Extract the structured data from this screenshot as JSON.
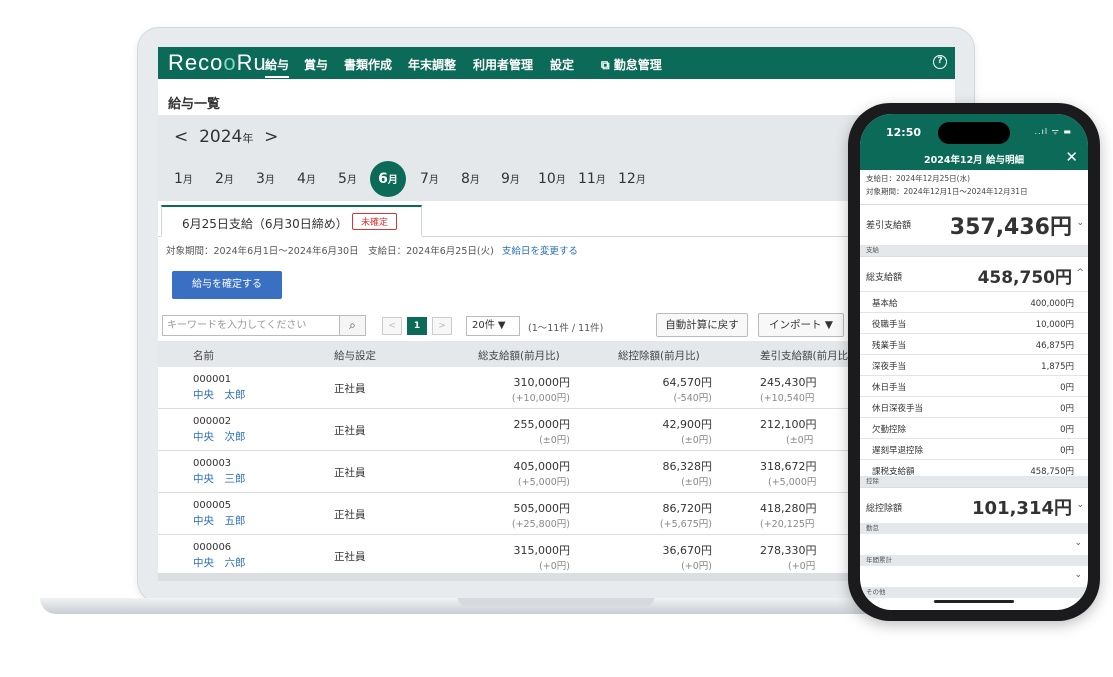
{
  "nav": {
    "logo_a": "Reco",
    "logo_b": "R",
    "logo_c": "u",
    "items": [
      "給与",
      "賞与",
      "書類作成",
      "年末調整",
      "利用者管理",
      "設定",
      "勤怠管理"
    ],
    "external_icon": "external-link-icon",
    "help": "?"
  },
  "page": {
    "title": "給与一覧",
    "year_prev": "<",
    "year": "2024",
    "year_suffix": "年",
    "year_next": ">",
    "month_suffix": "月",
    "months": [
      "1",
      "2",
      "3",
      "4",
      "5",
      "6",
      "7",
      "8",
      "9",
      "10",
      "11",
      "12"
    ],
    "active_month": "6"
  },
  "tab": {
    "label": "6月25日支給（6月30日締め）",
    "badge": "未確定"
  },
  "period": {
    "text": "対象期間：2024年6月1日〜2024年6月30日　支給日：2024年6月25日(火)",
    "link": "支給日を変更する"
  },
  "actions": {
    "confirm": "給与を確定する",
    "search_placeholder": "キーワードを入力してください",
    "page_prev": "<",
    "page_current": "1",
    "page_next": ">",
    "per_page": "20件 ▼",
    "count": "(1〜11件 / 11件)",
    "reset_auto": "自動計算に戻す",
    "import": "インポート ▼"
  },
  "table": {
    "headers": [
      "名前",
      "給与設定",
      "総支給額(前月比)",
      "総控除額(前月比)",
      "差引支給額(前月比"
    ],
    "rows": [
      {
        "code": "000001",
        "name": "中央　太郎",
        "setting": "正社員",
        "gross": "310,000円",
        "gross_diff": "(+10,000円)",
        "deduct": "64,570円",
        "deduct_diff": "(-540円)",
        "net": "245,430円",
        "net_diff": "(+10,540円"
      },
      {
        "code": "000002",
        "name": "中央　次郎",
        "setting": "正社員",
        "gross": "255,000円",
        "gross_diff": "(±0円)",
        "deduct": "42,900円",
        "deduct_diff": "(±0円)",
        "net": "212,100円",
        "net_diff": "(±0円"
      },
      {
        "code": "000003",
        "name": "中央　三郎",
        "setting": "正社員",
        "gross": "405,000円",
        "gross_diff": "(+5,000円)",
        "deduct": "86,328円",
        "deduct_diff": "(±0円)",
        "net": "318,672円",
        "net_diff": "(+5,000円"
      },
      {
        "code": "000005",
        "name": "中央　五郎",
        "setting": "正社員",
        "gross": "505,000円",
        "gross_diff": "(+25,800円)",
        "deduct": "86,720円",
        "deduct_diff": "(+5,675円)",
        "net": "418,280円",
        "net_diff": "(+20,125円"
      },
      {
        "code": "000006",
        "name": "中央　六郎",
        "setting": "正社員",
        "gross": "315,000円",
        "gross_diff": "(+0円)",
        "deduct": "36,670円",
        "deduct_diff": "(+0円)",
        "net": "278,330円",
        "net_diff": "(+0円"
      }
    ]
  },
  "phone": {
    "time": "12:50",
    "status": "..ıl ᯤ ▬",
    "title": "2024年12月 給与明細",
    "close": "✕",
    "pay_date": "支給日：2024年12月25日(水)",
    "period": "対象期間：2024年12月1日〜2024年12月31日",
    "net_label": "差引支給額",
    "net_value": "357,436円",
    "section_pay": "支給",
    "gross_label": "総支給額",
    "gross_value": "458,750円",
    "pay_items": [
      {
        "label": "基本給",
        "value": "400,000円"
      },
      {
        "label": "役職手当",
        "value": "10,000円"
      },
      {
        "label": "残業手当",
        "value": "46,875円"
      },
      {
        "label": "深夜手当",
        "value": "1,875円"
      },
      {
        "label": "休日手当",
        "value": "0円"
      },
      {
        "label": "休日深夜手当",
        "value": "0円"
      },
      {
        "label": "欠勤控除",
        "value": "0円"
      },
      {
        "label": "遅刻早退控除",
        "value": "0円"
      },
      {
        "label": "課税支給額",
        "value": "458,750円"
      }
    ],
    "section_deduct": "控除",
    "deduct_label": "総控除額",
    "deduct_value": "101,314円",
    "section_attendance": "勤怠",
    "section_annual": "年間累計",
    "section_other": "その他"
  },
  "colors": {
    "brand": "#0c6a58",
    "link": "#2a6fbf",
    "button": "#3a70c4",
    "badge": "#dd3333"
  }
}
